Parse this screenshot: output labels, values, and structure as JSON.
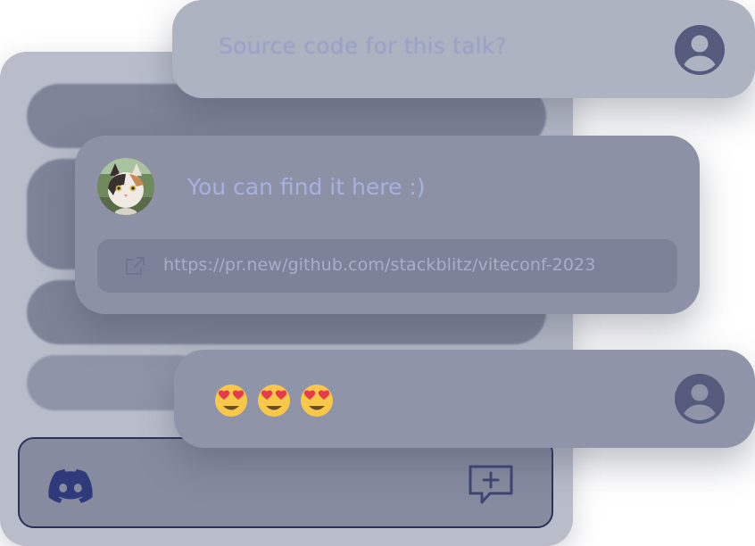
{
  "messages": [
    {
      "text": "Source code for this talk?"
    },
    {
      "text": "You can find it here :)",
      "link": "https://pr.new/github.com/stackblitz/viteconf-2023"
    },
    {
      "emojis": [
        "heart-eyes",
        "heart-eyes",
        "heart-eyes"
      ]
    }
  ],
  "colors": {
    "panel": "#b9bdca",
    "bubble_top": "#aeb3c2",
    "bubble_middle": "#8c91a6",
    "bubble_bottom": "#8f94a8",
    "input_border": "#2c3258",
    "icon": "#4a5078"
  },
  "icons": [
    "user-avatar-icon",
    "discord-icon",
    "new-message-icon",
    "external-link-icon",
    "heart-eyes-emoji"
  ]
}
